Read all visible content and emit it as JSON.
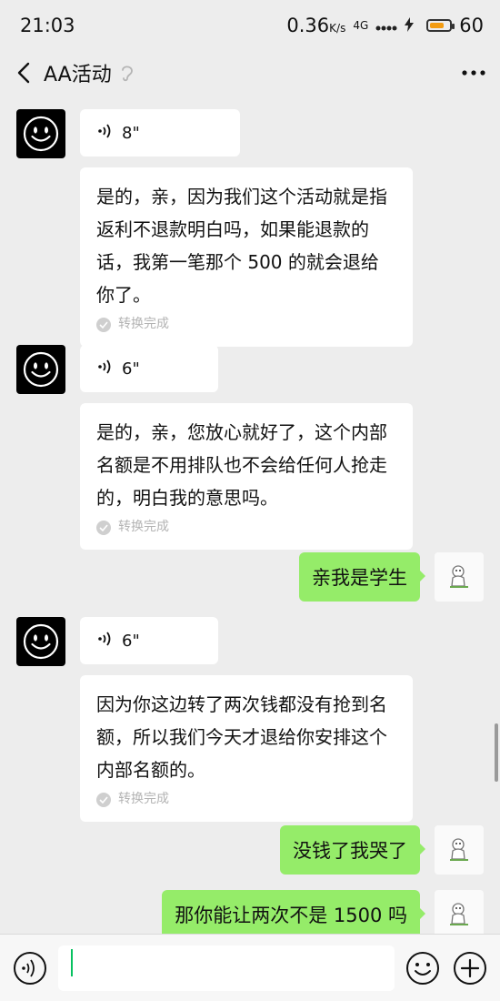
{
  "status_bar": {
    "time": "21:03",
    "speed_value": "0.36",
    "speed_unit": "K/s",
    "network": "4G",
    "battery": "60"
  },
  "header": {
    "title": "AA活动"
  },
  "messages": [
    {
      "direction": "in",
      "voice_duration": "8\"",
      "text": "是的，亲，因为我们这个活动就是指返利不退款明白吗，如果能退款的话，我第一笔那个 500 的就会退给你了。",
      "convert_status": "转换完成"
    },
    {
      "direction": "in",
      "voice_duration": "6\"",
      "text": "是的，亲，您放心就好了，这个内部名额是不用排队也不会给任何人抢走的，明白我的意思吗。",
      "convert_status": "转换完成"
    },
    {
      "direction": "out",
      "text": "亲我是学生"
    },
    {
      "direction": "in",
      "voice_duration": "6\"",
      "text": "因为你这边转了两次钱都没有抢到名额，所以我们今天才退给你安排这个内部名额的。",
      "convert_status": "转换完成"
    },
    {
      "direction": "out",
      "text": "没钱了我哭了"
    },
    {
      "direction": "out",
      "text": "那你能让两次不是 1500 吗"
    }
  ],
  "colors": {
    "background": "#ededed",
    "outgoing_bubble": "#95ec69",
    "incoming_bubble": "#ffffff",
    "accent": "#07c160"
  },
  "input": {
    "value": ""
  }
}
